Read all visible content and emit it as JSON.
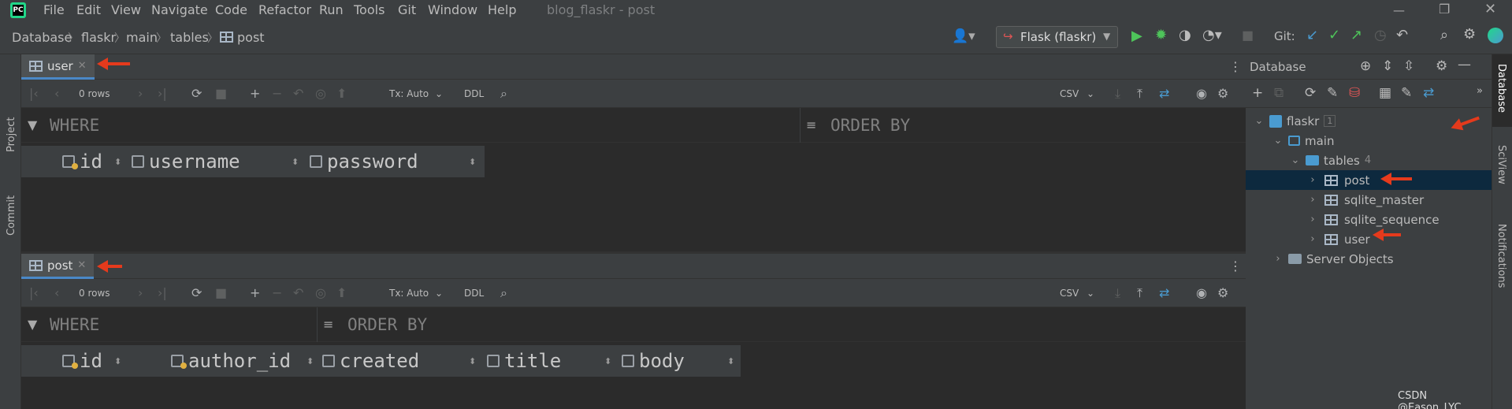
{
  "window": {
    "title": "blog_flaskr - post",
    "menu": [
      "File",
      "Edit",
      "View",
      "Navigate",
      "Code",
      "Refactor",
      "Run",
      "Tools",
      "Git",
      "Window",
      "Help"
    ]
  },
  "breadcrumb": [
    "Database",
    "flaskr",
    "main",
    "tables",
    "post"
  ],
  "run_config": "Flask (flaskr)",
  "git_label": "Git:",
  "left_strip": [
    "Project",
    "Commit"
  ],
  "right_strip": [
    "Database",
    "SciView",
    "Notifications"
  ],
  "editors": [
    {
      "tab": "user",
      "rows_label": "0 rows",
      "tx_label": "Tx: Auto",
      "ddl_label": "DDL",
      "csv_label": "CSV",
      "where_label": "WHERE",
      "order_label": "ORDER BY",
      "columns": [
        "id",
        "username",
        "password"
      ]
    },
    {
      "tab": "post",
      "rows_label": "0 rows",
      "tx_label": "Tx: Auto",
      "ddl_label": "DDL",
      "csv_label": "CSV",
      "where_label": "WHERE",
      "order_label": "ORDER BY",
      "columns": [
        "id",
        "author_id",
        "created",
        "title",
        "body"
      ]
    }
  ],
  "db_panel": {
    "title": "Database",
    "tree": {
      "root": "flaskr",
      "root_badge": "1",
      "schema": "main",
      "tables_label": "tables",
      "tables_count": "4",
      "tables": [
        "post",
        "sqlite_master",
        "sqlite_sequence",
        "user"
      ],
      "server_objects": "Server Objects"
    }
  },
  "watermark": "CSDN @Eason_LYC",
  "accent_color": "#4a88c7",
  "annotation_color": "#e53a1c"
}
